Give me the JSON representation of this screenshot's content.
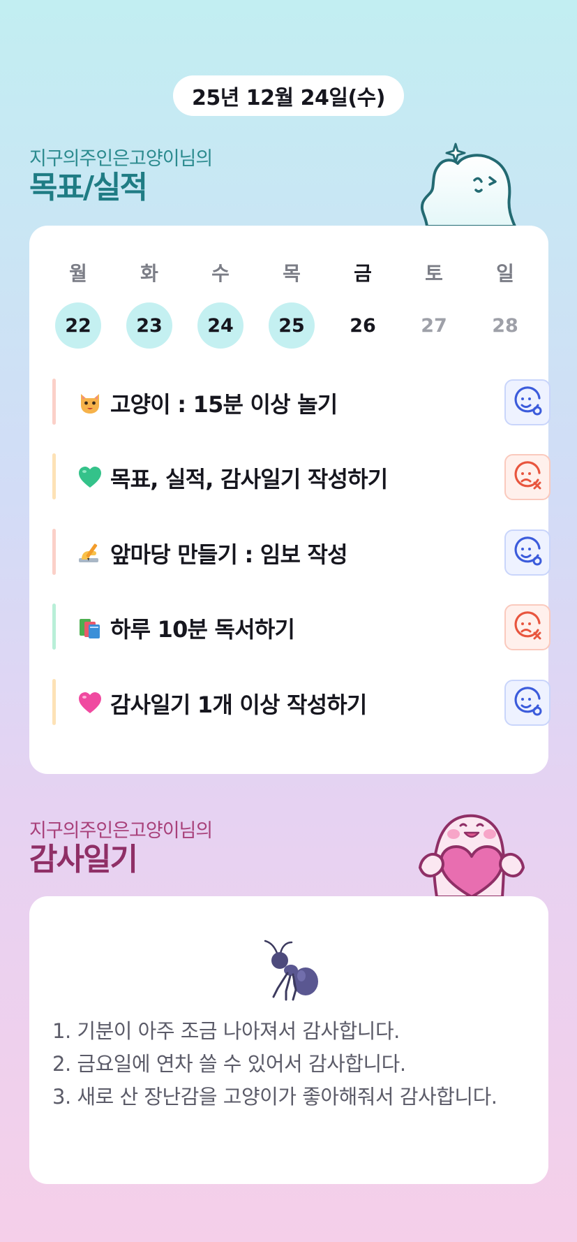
{
  "header": {
    "date": "25년 12월 24일(수)"
  },
  "goals_section": {
    "subtitle": "지구의주인은고양이님의",
    "title": "목표/실적"
  },
  "week": {
    "days": [
      {
        "name": "월",
        "num": "22",
        "state": "done"
      },
      {
        "name": "화",
        "num": "23",
        "state": "done"
      },
      {
        "name": "수",
        "num": "24",
        "state": "done"
      },
      {
        "name": "목",
        "num": "25",
        "state": "done"
      },
      {
        "name": "금",
        "num": "26",
        "state": "today"
      },
      {
        "name": "토",
        "num": "27",
        "state": "future"
      },
      {
        "name": "일",
        "num": "28",
        "state": "future"
      }
    ]
  },
  "goals": [
    {
      "icon": "cat-face-icon",
      "text": "고양이 : 15분 이상 놀기",
      "status": "achieved",
      "bar_color": "#fbd0c8"
    },
    {
      "icon": "green-heart-icon",
      "text": "목표, 실적, 감사일기 작성하기",
      "status": "missed",
      "bar_color": "#fde2b6"
    },
    {
      "icon": "writing-hand-icon",
      "text": "앞마당 만들기 : 임보 작성",
      "status": "achieved",
      "bar_color": "#fbd0c8"
    },
    {
      "icon": "books-icon",
      "text": "하루 10분 독서하기",
      "status": "missed",
      "bar_color": "#b9efd8"
    },
    {
      "icon": "pink-heart-icon",
      "text": "감사일기 1개 이상 작성하기",
      "status": "achieved",
      "bar_color": "#fde2b6"
    }
  ],
  "gratitude_section": {
    "subtitle": "지구의주인은고양이님의",
    "title": "감사일기"
  },
  "gratitude": {
    "icon": "ant-icon",
    "lines": [
      "1. 기분이 아주 조금 나아져서 감사합니다.",
      "2. 금요일에 연차 쓸 수 있어서 감사합니다.",
      "3. 새로 산 장난감을 고양이가 좋아해줘서 감사합니다."
    ]
  },
  "colors": {
    "accent_teal": "#1f7c84",
    "accent_pink": "#8f2f66",
    "done_day": "#c4f0f1",
    "ok_status": "#3b5bdb",
    "fail_status": "#e8553e"
  }
}
